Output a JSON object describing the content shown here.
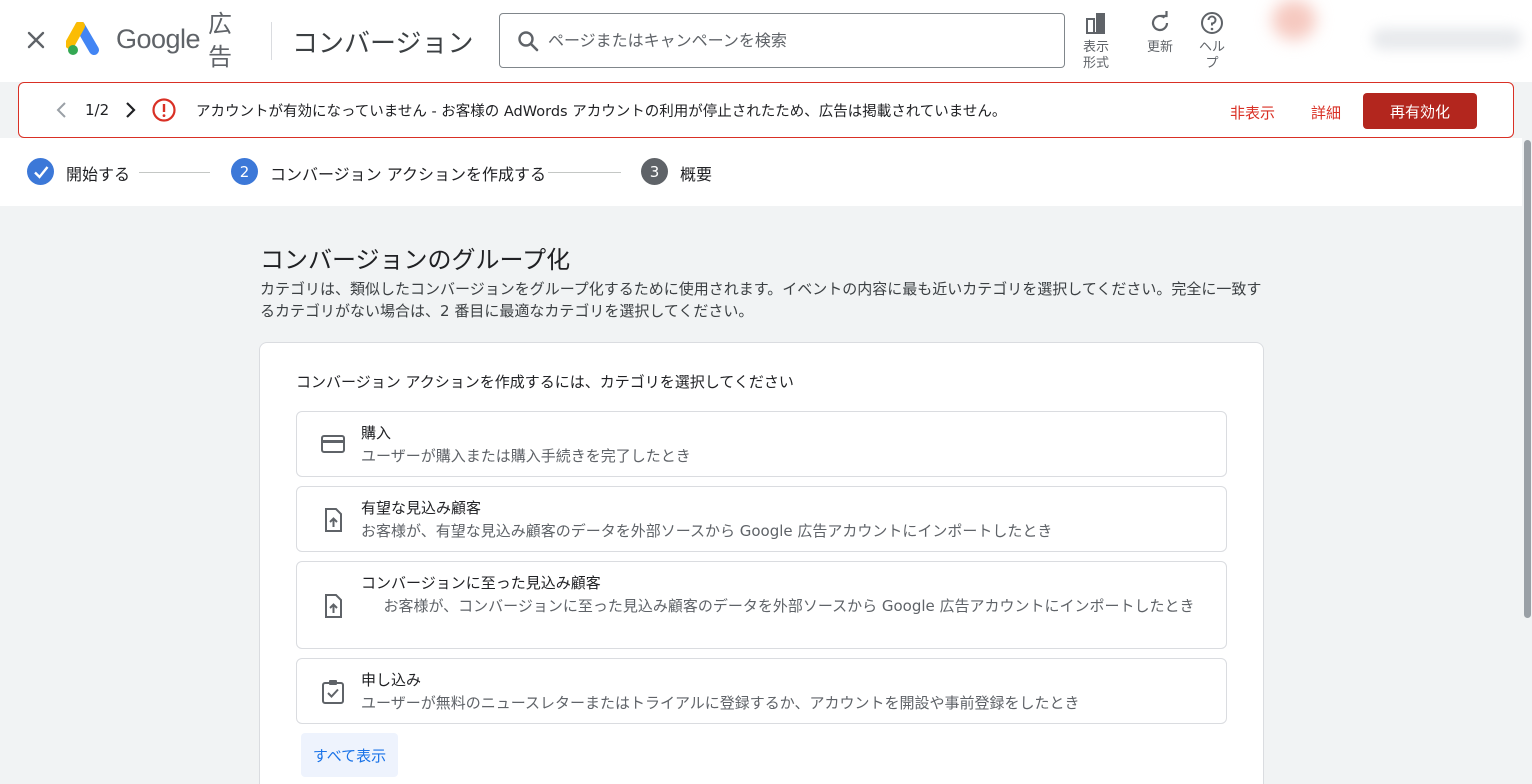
{
  "header": {
    "brand": "Google",
    "brand_ad": "広告",
    "page_title": "コンバージョン",
    "search_placeholder": "ページまたはキャンペーンを検索",
    "tools": [
      {
        "label": "表示\n形式",
        "icon": "view-format-icon"
      },
      {
        "label": "更新",
        "icon": "refresh-icon"
      },
      {
        "label": "ヘル\nプ",
        "icon": "help-icon"
      }
    ]
  },
  "alert": {
    "counter": "1/2",
    "message": "アカウントが有効になっていません - お客様の AdWords アカウントの利用が停止されたため、広告は掲載されていません。",
    "hide_label": "非表示",
    "detail_label": "詳細",
    "reactivate_label": "再有効化",
    "color": "#d93025"
  },
  "stepper": {
    "steps": [
      {
        "number": "",
        "label": "開始する",
        "state": "done"
      },
      {
        "number": "2",
        "label": "コンバージョン アクションを作成する",
        "state": "active"
      },
      {
        "number": "3",
        "label": "概要",
        "state": "pending"
      }
    ]
  },
  "section": {
    "title": "コンバージョンのグループ化",
    "description": "カテゴリは、類似したコンバージョンをグループ化するために使用されます。イベントの内容に最も近いカテゴリを選択してください。完全に一致するカテゴリがない場合は、2 番目に最適なカテゴリを選択してください。"
  },
  "card": {
    "heading": "コンバージョン アクションを作成するには、カテゴリを選択してください",
    "options": [
      {
        "title": "購入",
        "description": "ユーザーが購入または購入手続きを完了したとき",
        "icon": "credit-card-icon"
      },
      {
        "title": "有望な見込み顧客",
        "description": "お客様が、有望な見込み顧客のデータを外部ソースから Google 広告アカウントにインポートしたとき",
        "icon": "file-upload-icon"
      },
      {
        "title": "コンバージョンに至った見込み顧客",
        "description": "お客様が、コンバージョンに至った見込み顧客のデータを外部ソースから Google 広告アカウントにインポートしたとき",
        "icon": "file-upload-icon"
      },
      {
        "title": "申し込み",
        "description": "ユーザーが無料のニュースレターまたはトライアルに登録するか、アカウントを開設や事前登録をしたとき",
        "icon": "clipboard-check-icon"
      }
    ],
    "show_all_label": "すべて表示"
  },
  "colors": {
    "accent_blue": "#1a73e8",
    "step_blue": "#3c78d8",
    "step_gray": "#5f6368",
    "danger_button": "#b3261e"
  }
}
